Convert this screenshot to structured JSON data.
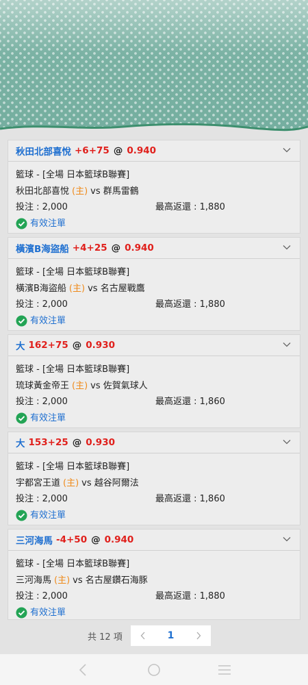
{
  "bets": [
    {
      "selection": "秋田北部喜悅",
      "line": "+6+75",
      "at": "@",
      "odds": "0.940",
      "sport_league": "籃球 - [全場 日本籃球B聯賽]",
      "home_team": "秋田北部喜悅",
      "home_tag": "(主)",
      "vs": "vs",
      "away_team": "群馬雷鶴",
      "stake": "投注 : 2,000",
      "max_return": "最高返還 : 1,880",
      "status": "有效注單"
    },
    {
      "selection": "橫濱B海盜船",
      "line": "+4+25",
      "at": "@",
      "odds": "0.940",
      "sport_league": "籃球 - [全場 日本籃球B聯賽]",
      "home_team": "橫濱B海盜船",
      "home_tag": "(主)",
      "vs": "vs",
      "away_team": "名古屋戰鷹",
      "stake": "投注 : 2,000",
      "max_return": "最高返還 : 1,880",
      "status": "有效注單"
    },
    {
      "selection": "大",
      "line": "162+75",
      "at": "@",
      "odds": "0.930",
      "sport_league": "籃球 - [全場 日本籃球B聯賽]",
      "home_team": "琉球黃金帝王",
      "home_tag": "(主)",
      "vs": "vs",
      "away_team": "佐賀氣球人",
      "stake": "投注 : 2,000",
      "max_return": "最高返還 : 1,860",
      "status": "有效注單"
    },
    {
      "selection": "大",
      "line": "153+25",
      "at": "@",
      "odds": "0.930",
      "sport_league": "籃球 - [全場 日本籃球B聯賽]",
      "home_team": "宇都宮王道",
      "home_tag": "(主)",
      "vs": "vs",
      "away_team": "越谷阿爾法",
      "stake": "投注 : 2,000",
      "max_return": "最高返還 : 1,860",
      "status": "有效注單"
    },
    {
      "selection": "三河海馬",
      "line": "-4+50",
      "at": "@",
      "odds": "0.940",
      "sport_league": "籃球 - [全場 日本籃球B聯賽]",
      "home_team": "三河海馬",
      "home_tag": "(主)",
      "vs": "vs",
      "away_team": "名古屋鑽石海豚",
      "stake": "投注 : 2,000",
      "max_return": "最高返還 : 1,880",
      "status": "有效注單"
    }
  ],
  "pagination": {
    "total": "共 12 項",
    "current_page": "1"
  },
  "icons": {
    "expand": "chevron-down-icon",
    "status": "check-circle-icon",
    "prev": "chevron-left-icon",
    "next": "chevron-right-icon",
    "nav_back": "back-icon",
    "nav_home": "home-icon",
    "nav_menu": "menu-icon"
  },
  "colors": {
    "selection": "#1e6fd0",
    "line": "#e0201c",
    "home_tag": "#ef8a1a",
    "status_green": "#23a455",
    "header_bg": "#74ae9f"
  }
}
